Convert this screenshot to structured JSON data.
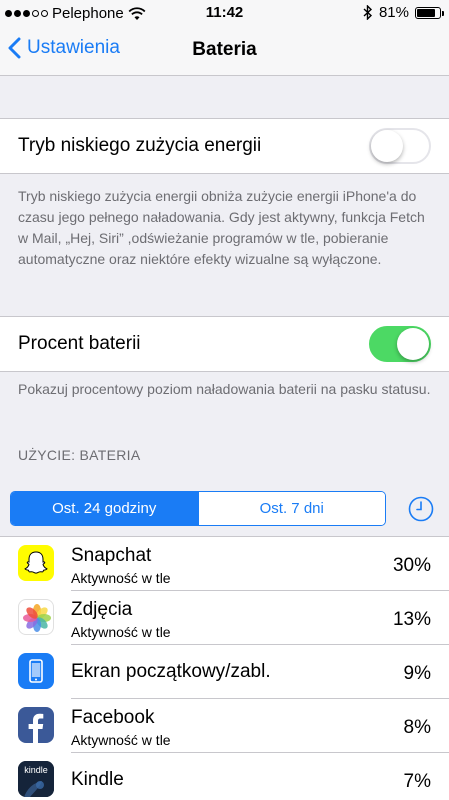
{
  "status_bar": {
    "carrier": "Pelephone",
    "time": "11:42",
    "battery_percent": "81%",
    "battery_level": 0.81,
    "icons": [
      "signal-dots-icon",
      "wifi-icon",
      "bluetooth-icon",
      "battery-icon"
    ]
  },
  "nav": {
    "back_label": "Ustawienia",
    "title": "Bateria"
  },
  "low_power": {
    "label": "Tryb niskiego zużycia energii",
    "enabled": false,
    "footer": "Tryb niskiego zużycia energii obniża zużycie energii iPhone'a do czasu jego pełnego naładowania. Gdy jest aktywny, funkcja Fetch w Mail, „Hej, Siri” ,odświeżanie programów w tle, pobieranie automatyczne oraz niektóre efekty wizualne są wyłączone."
  },
  "battery_percentage": {
    "label": "Procent baterii",
    "enabled": true,
    "footer": "Pokazuj procentowy poziom naładowania baterii na pasku statusu."
  },
  "usage": {
    "header": "UŻYCIE: BATERIA",
    "segments": [
      "Ost. 24 godziny",
      "Ost. 7 dni"
    ],
    "selected_segment": "Ost. 24 godziny",
    "apps": [
      {
        "name": "Snapchat",
        "subtitle": "Aktywność w tle",
        "percent": "30%",
        "icon": "snapchat-icon"
      },
      {
        "name": "Zdjęcia",
        "subtitle": "Aktywność w tle",
        "percent": "13%",
        "icon": "photos-icon"
      },
      {
        "name": "Ekran początkowy/zabl.",
        "subtitle": "",
        "percent": "9%",
        "icon": "home-lock-screen-icon"
      },
      {
        "name": "Facebook",
        "subtitle": "Aktywność w tle",
        "percent": "8%",
        "icon": "facebook-icon"
      },
      {
        "name": "Kindle",
        "subtitle": "",
        "percent": "7%",
        "icon": "kindle-icon",
        "icon_text": "kindle"
      }
    ]
  },
  "colors": {
    "accent": "#1a7cf5",
    "toggle_on": "#4cd964",
    "background": "#efeff4"
  }
}
